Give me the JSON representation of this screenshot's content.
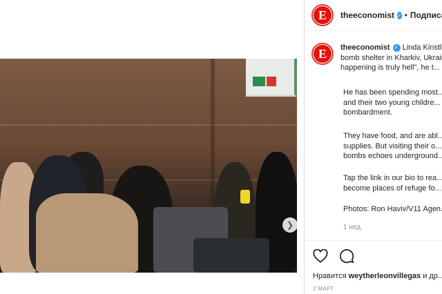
{
  "post": {
    "username": "theeconomist",
    "follow_label": "Подписаться",
    "avatar_letter": "E",
    "caption_first_line": "Linda Kinstler...",
    "caption_lines": [
      "bomb shelter in Kharkiv, Ukraine...",
      "happening is truly hell\", he t..."
    ],
    "paragraphs": [
      [
        "He has been spending most...",
        "and their two young childre...",
        "bombardment."
      ],
      [
        "They have food, and are abl...",
        "supplies. But visiting their o...",
        "bombs echoes underground..."
      ],
      [
        "Tap the link in our bio to rea...",
        "become places of refuge fo..."
      ],
      [
        "Photos: Ron Haviv/V11 Agen..."
      ]
    ],
    "time_ago": "1 нед.",
    "likes_prefix": "Нравится",
    "likes_user": "weytherleonvillegas",
    "likes_suffix": "и др...",
    "date": "2 МАРТ"
  },
  "icons": {
    "next": "chevron-right-icon",
    "like": "heart-icon",
    "comment": "comment-icon",
    "verified": "verified-badge-icon"
  },
  "colors": {
    "brand_red": "#e3120b",
    "verified_blue": "#3897f0",
    "muted": "#8e8e8e"
  }
}
